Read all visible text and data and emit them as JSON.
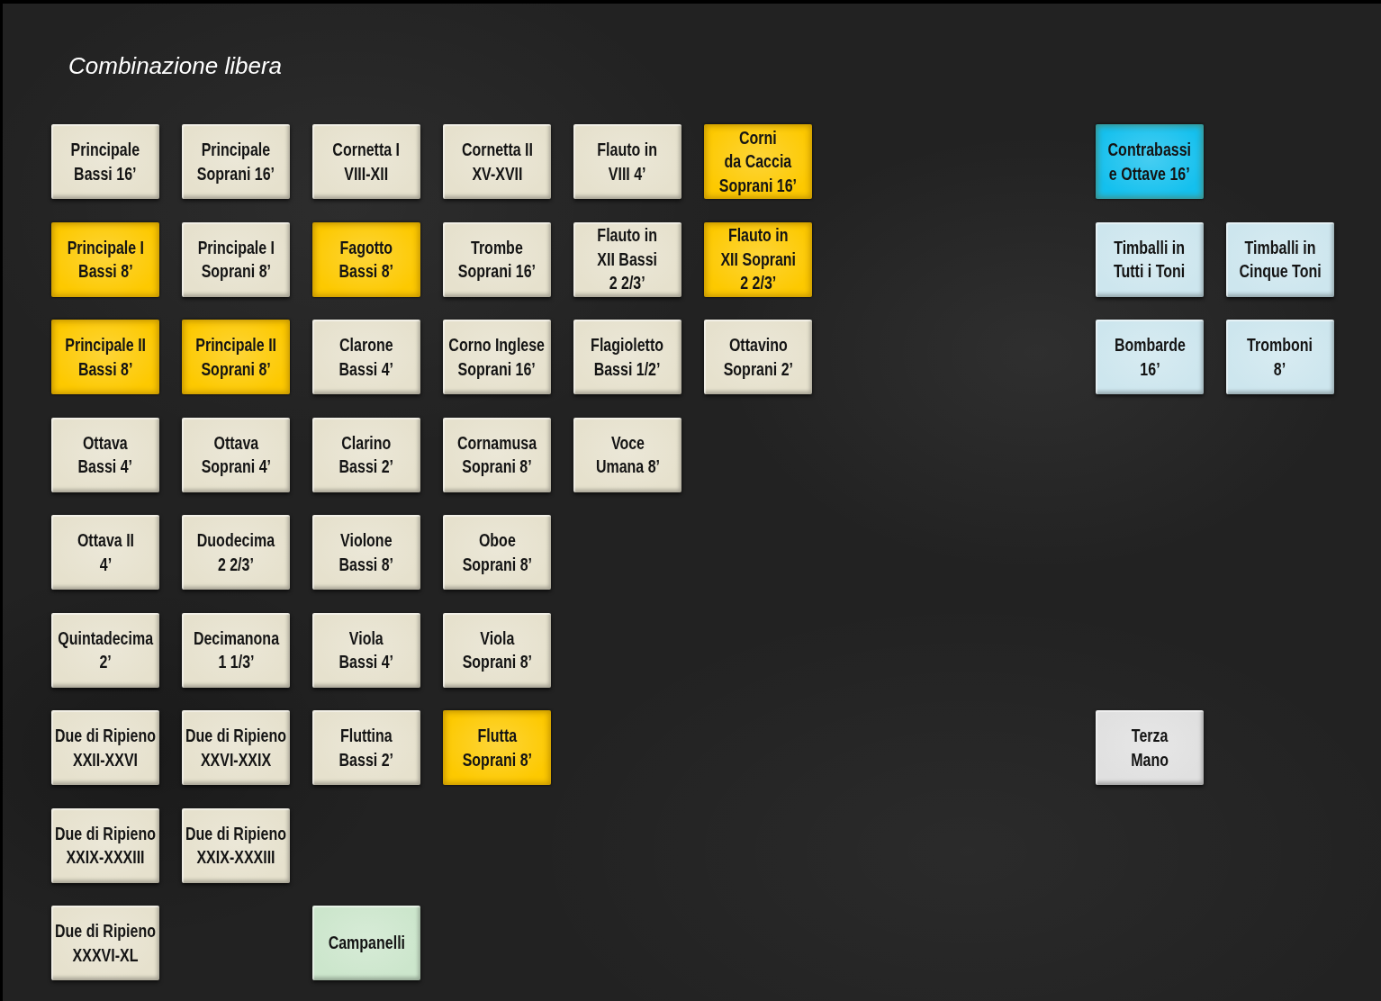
{
  "title": "Combinazione libera",
  "rows": [
    {
      "stops": [
        {
          "kind": "stop",
          "label": "Principale\nBassi 16’",
          "selected": false,
          "color": "#e6e1cd"
        },
        {
          "kind": "stop",
          "label": "Principale\nSoprani 16’",
          "selected": false,
          "color": "#e6e1cd"
        },
        {
          "kind": "stop",
          "label": "Cornetta I\nVIII-XII",
          "selected": false,
          "color": "#e6e1cd"
        },
        {
          "kind": "stop",
          "label": "Cornetta II\nXV-XVII",
          "selected": false,
          "color": "#e6e1cd"
        },
        {
          "kind": "stop",
          "label": "Flauto in\nVIII 4’",
          "selected": false,
          "color": "#e6e1cd"
        },
        {
          "kind": "stop",
          "label": "Corni\nda Caccia\nSoprani 16’",
          "selected": true,
          "color": "#fdc900"
        },
        {
          "kind": "empty"
        },
        {
          "kind": "empty"
        },
        {
          "kind": "stop",
          "label": "Contrabassi\ne Ottave 16’",
          "selected": true,
          "color": "#14c0ee"
        }
      ]
    },
    {
      "stops": [
        {
          "kind": "stop",
          "label": "Principale I\nBassi 8’",
          "selected": true,
          "color": "#fdc900"
        },
        {
          "kind": "stop",
          "label": "Principale I\nSoprani 8’",
          "selected": false,
          "color": "#e6e1cd"
        },
        {
          "kind": "stop",
          "label": "Fagotto\nBassi 8’",
          "selected": true,
          "color": "#fdc900"
        },
        {
          "kind": "stop",
          "label": "Trombe\nSoprani 16’",
          "selected": false,
          "color": "#e6e1cd"
        },
        {
          "kind": "stop",
          "label": "Flauto in\nXII Bassi\n2 2/3’",
          "selected": false,
          "color": "#e6e1cd"
        },
        {
          "kind": "stop",
          "label": "Flauto in\nXII Soprani\n2 2/3’",
          "selected": true,
          "color": "#fdc900"
        },
        {
          "kind": "empty"
        },
        {
          "kind": "empty"
        },
        {
          "kind": "stop",
          "label": "Timballi in\nTutti i Toni",
          "selected": false,
          "color": "#cde6ee"
        },
        {
          "kind": "stop",
          "label": "Timballi in\nCinque Toni",
          "selected": false,
          "color": "#cde6ee"
        }
      ]
    },
    {
      "stops": [
        {
          "kind": "stop",
          "label": "Principale II\nBassi 8’",
          "selected": true,
          "color": "#fdc900"
        },
        {
          "kind": "stop",
          "label": "Principale II\nSoprani 8’",
          "selected": true,
          "color": "#fdc900"
        },
        {
          "kind": "stop",
          "label": "Clarone\nBassi 4’",
          "selected": false,
          "color": "#e6e1cd"
        },
        {
          "kind": "stop",
          "label": "Corno Inglese\nSoprani 16’",
          "selected": false,
          "color": "#e6e1cd"
        },
        {
          "kind": "stop",
          "label": "Flagioletto\nBassi 1/2’",
          "selected": false,
          "color": "#e6e1cd"
        },
        {
          "kind": "stop",
          "label": "Ottavino\nSoprani 2’",
          "selected": false,
          "color": "#e6e1cd"
        },
        {
          "kind": "empty"
        },
        {
          "kind": "empty"
        },
        {
          "kind": "stop",
          "label": "Bombarde\n16’",
          "selected": false,
          "color": "#cde6ee"
        },
        {
          "kind": "stop",
          "label": "Tromboni\n8’",
          "selected": false,
          "color": "#cde6ee"
        }
      ]
    },
    {
      "stops": [
        {
          "kind": "stop",
          "label": "Ottava\nBassi 4’",
          "selected": false,
          "color": "#e6e1cd"
        },
        {
          "kind": "stop",
          "label": "Ottava\nSoprani 4’",
          "selected": false,
          "color": "#e6e1cd"
        },
        {
          "kind": "stop",
          "label": "Clarino\nBassi 2’",
          "selected": false,
          "color": "#e6e1cd"
        },
        {
          "kind": "stop",
          "label": "Cornamusa\nSoprani 8’",
          "selected": false,
          "color": "#e6e1cd"
        },
        {
          "kind": "stop",
          "label": "Voce\nUmana 8’",
          "selected": false,
          "color": "#e6e1cd"
        }
      ]
    },
    {
      "stops": [
        {
          "kind": "stop",
          "label": "Ottava II\n4’",
          "selected": false,
          "color": "#e6e1cd"
        },
        {
          "kind": "stop",
          "label": "Duodecima\n2 2/3’",
          "selected": false,
          "color": "#e6e1cd"
        },
        {
          "kind": "stop",
          "label": "Violone\nBassi 8’",
          "selected": false,
          "color": "#e6e1cd"
        },
        {
          "kind": "stop",
          "label": "Oboe\nSoprani 8’",
          "selected": false,
          "color": "#e6e1cd"
        }
      ]
    },
    {
      "stops": [
        {
          "kind": "stop",
          "label": "Quintadecima\n2’",
          "selected": false,
          "color": "#e6e1cd"
        },
        {
          "kind": "stop",
          "label": "Decimanona\n1 1/3’",
          "selected": false,
          "color": "#e6e1cd"
        },
        {
          "kind": "stop",
          "label": "Viola\nBassi 4’",
          "selected": false,
          "color": "#e6e1cd"
        },
        {
          "kind": "stop",
          "label": "Viola\nSoprani 8’",
          "selected": false,
          "color": "#e6e1cd"
        }
      ]
    },
    {
      "stops": [
        {
          "kind": "stop",
          "label": "Due di Ripieno\nXXII-XXVI",
          "selected": false,
          "color": "#e6e1cd"
        },
        {
          "kind": "stop",
          "label": "Due di Ripieno\nXXVI-XXIX",
          "selected": false,
          "color": "#e6e1cd"
        },
        {
          "kind": "stop",
          "label": "Fluttina\nBassi 2’",
          "selected": false,
          "color": "#e6e1cd"
        },
        {
          "kind": "stop",
          "label": "Flutta\nSoprani 8’",
          "selected": true,
          "color": "#fdc900"
        },
        {
          "kind": "empty"
        },
        {
          "kind": "empty"
        },
        {
          "kind": "empty"
        },
        {
          "kind": "empty"
        },
        {
          "kind": "stop",
          "label": "Terza\nMano",
          "selected": false,
          "color": "#e0e0e0"
        }
      ]
    },
    {
      "stops": [
        {
          "kind": "stop",
          "label": "Due di Ripieno\nXXIX-XXXIII",
          "selected": false,
          "color": "#e6e1cd"
        },
        {
          "kind": "stop",
          "label": "Due di Ripieno\nXXIX-XXXIII",
          "selected": false,
          "color": "#e6e1cd"
        }
      ]
    },
    {
      "stops": [
        {
          "kind": "stop",
          "label": "Due di Ripieno\nXXXVI-XL",
          "selected": false,
          "color": "#e6e1cd"
        },
        {
          "kind": "empty"
        },
        {
          "kind": "stop",
          "label": "Campanelli",
          "selected": false,
          "color": "#cce6cc"
        }
      ]
    }
  ]
}
